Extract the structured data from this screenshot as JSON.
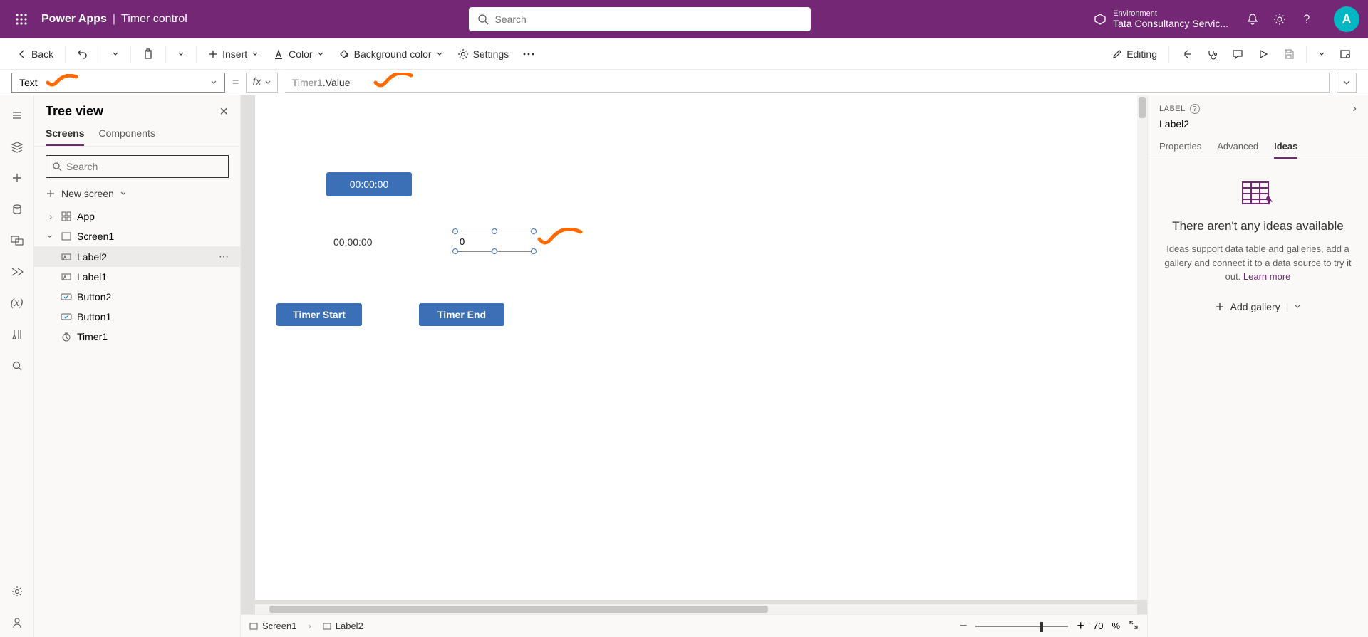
{
  "header": {
    "app_name": "Power Apps",
    "separator": "|",
    "page_name": "Timer control",
    "search_placeholder": "Search",
    "env_label": "Environment",
    "env_name": "Tata Consultancy Servic...",
    "avatar_letter": "A"
  },
  "cmdbar": {
    "back": "Back",
    "insert": "Insert",
    "color": "Color",
    "bgcolor": "Background color",
    "settings": "Settings",
    "editing": "Editing"
  },
  "formula": {
    "property": "Text",
    "fx_label": "fx",
    "formula_obj": "Timer1",
    "formula_prop": ".Value"
  },
  "treeview": {
    "title": "Tree view",
    "tab_screens": "Screens",
    "tab_components": "Components",
    "search_placeholder": "Search",
    "new_screen": "New screen",
    "app": "App",
    "screen1": "Screen1",
    "label2": "Label2",
    "label1": "Label1",
    "button2": "Button2",
    "button1": "Button1",
    "timer1": "Timer1"
  },
  "canvas": {
    "timer_display": "00:00:00",
    "label1_text": "00:00:00",
    "label2_text": "0",
    "btn_start": "Timer Start",
    "btn_end": "Timer End"
  },
  "canvas_footer": {
    "crumb_screen": "Screen1",
    "crumb_label": "Label2",
    "zoom_value": "70",
    "zoom_unit": "%"
  },
  "right": {
    "type": "LABEL",
    "name": "Label2",
    "tab_props": "Properties",
    "tab_adv": "Advanced",
    "tab_ideas": "Ideas",
    "ideas_title": "There aren't any ideas available",
    "ideas_text": "Ideas support data table and galleries, add a gallery and connect it to a data source to try it out. ",
    "ideas_link": "Learn more",
    "add_gallery": "Add gallery"
  }
}
